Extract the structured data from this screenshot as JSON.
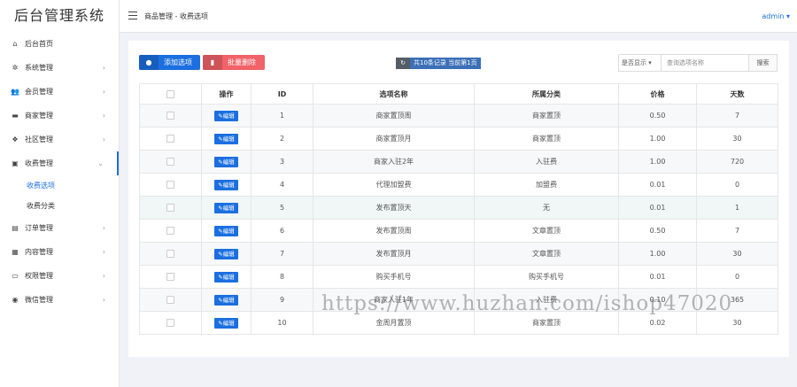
{
  "app": {
    "title": "后台管理系统"
  },
  "sidebar": {
    "items": [
      {
        "label": "后台首页",
        "icon": "home-icon",
        "glyph": "⌂",
        "has_chevron": false
      },
      {
        "label": "系统管理",
        "icon": "gear-icon",
        "glyph": "✲",
        "has_chevron": true
      },
      {
        "label": "会员管理",
        "icon": "users-icon",
        "glyph": "👥",
        "has_chevron": true
      },
      {
        "label": "商家管理",
        "icon": "store-icon",
        "glyph": "▬",
        "has_chevron": true
      },
      {
        "label": "社区管理",
        "icon": "dropbox-icon",
        "glyph": "❖",
        "has_chevron": true
      },
      {
        "label": "收费管理",
        "icon": "shopping-bag-icon",
        "glyph": "▣",
        "has_chevron": true,
        "expanded": true
      }
    ],
    "subitems": [
      {
        "label": "收费选项",
        "active": true
      },
      {
        "label": "收费分类",
        "active": false
      }
    ],
    "items_after": [
      {
        "label": "订单管理",
        "icon": "clipboard-icon",
        "glyph": "▤"
      },
      {
        "label": "内容管理",
        "icon": "file-icon",
        "glyph": "▦"
      },
      {
        "label": "权限管理",
        "icon": "monitor-icon",
        "glyph": "▭"
      },
      {
        "label": "微信管理",
        "icon": "wechat-icon",
        "glyph": "◉"
      }
    ],
    "chevron": "›",
    "chevron_open": "⌄"
  },
  "header": {
    "breadcrumb": "商品管理 - 收费选项",
    "user": "admin ▾"
  },
  "toolbar": {
    "add_label": "添加选项",
    "delete_label": "批量删除",
    "count_text": "共10条记录 当前第1页",
    "filter_select": "是否显示 ▾",
    "search_placeholder": "查询选项名称",
    "search_button": "搜索"
  },
  "table": {
    "columns": [
      "",
      "操作",
      "ID",
      "选项名称",
      "所属分类",
      "价格",
      "天数"
    ],
    "edit_label": "✎编辑",
    "rows": [
      {
        "id": "1",
        "name": "商家置顶周",
        "category": "商家置顶",
        "price": "0.50",
        "days": "7"
      },
      {
        "id": "2",
        "name": "商家置顶月",
        "category": "商家置顶",
        "price": "1.00",
        "days": "30"
      },
      {
        "id": "3",
        "name": "商家入驻2年",
        "category": "入驻费",
        "price": "1.00",
        "days": "720"
      },
      {
        "id": "4",
        "name": "代理加盟费",
        "category": "加盟费",
        "price": "0.01",
        "days": "0"
      },
      {
        "id": "5",
        "name": "发布置顶天",
        "category": "无",
        "price": "0.01",
        "days": "1"
      },
      {
        "id": "6",
        "name": "发布置顶周",
        "category": "文章置顶",
        "price": "0.50",
        "days": "7"
      },
      {
        "id": "7",
        "name": "发布置顶月",
        "category": "文章置顶",
        "price": "1.00",
        "days": "30"
      },
      {
        "id": "8",
        "name": "购买手机号",
        "category": "购买手机号",
        "price": "0.01",
        "days": "0"
      },
      {
        "id": "9",
        "name": "商家入驻1年",
        "category": "入驻费",
        "price": "0.10",
        "days": "365"
      },
      {
        "id": "10",
        "name": "金周月置顶",
        "category": "商家置顶",
        "price": "0.02",
        "days": "30"
      }
    ]
  },
  "watermark": "https://www.huzhan.com/ishop47020",
  "colors": {
    "primary": "#1b6fe0",
    "danger": "#f16368",
    "count_badge": "#3b6fb6"
  }
}
